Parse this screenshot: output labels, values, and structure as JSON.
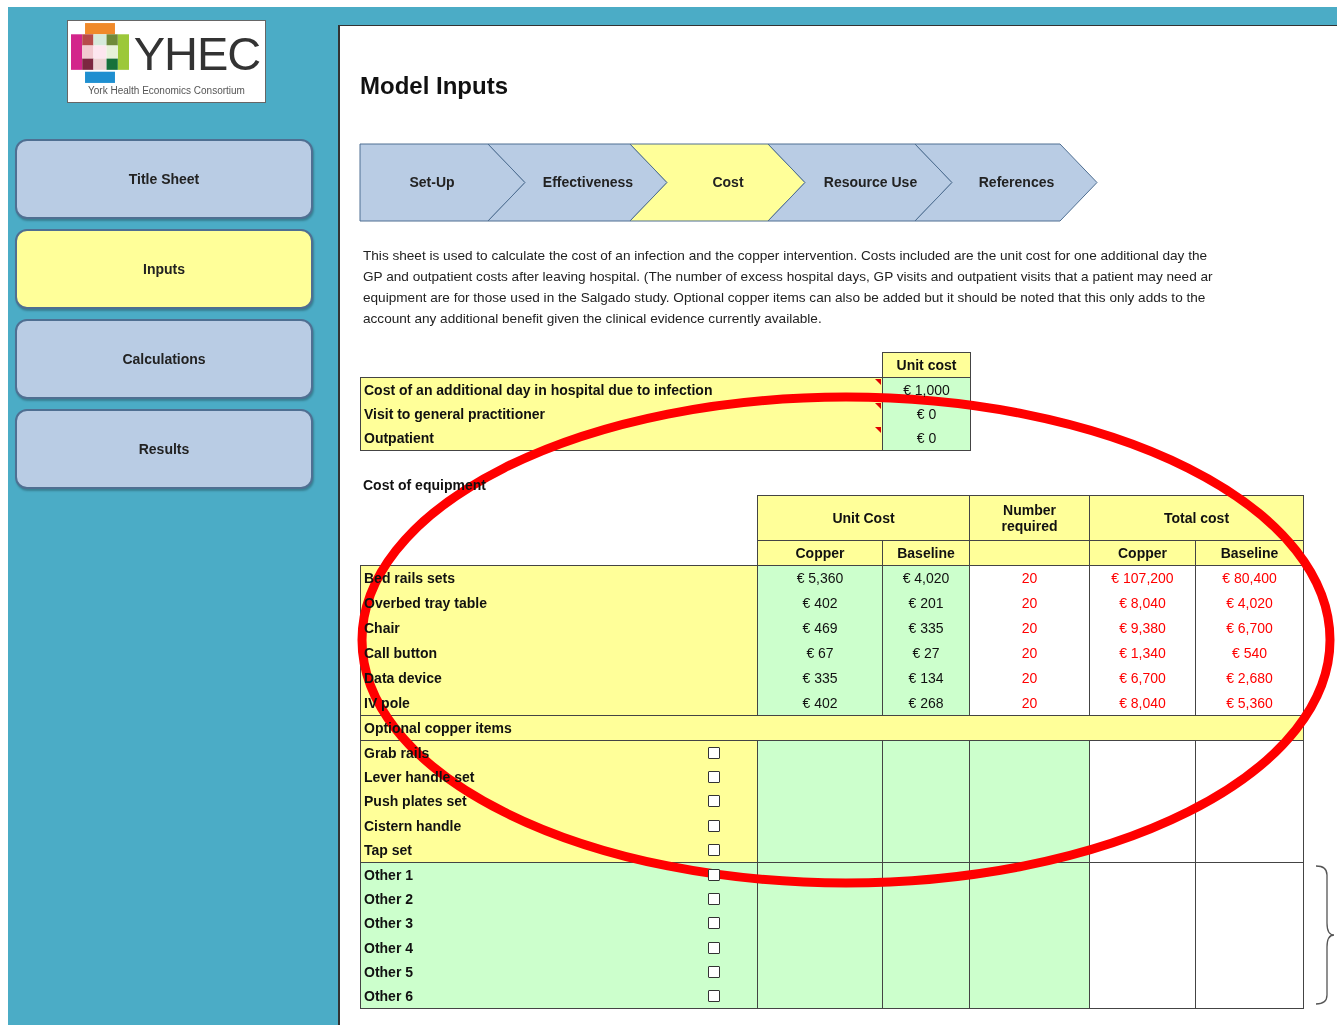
{
  "logo": {
    "title": "YHEC",
    "subtitle": "York Health Economics Consortium"
  },
  "nav": [
    {
      "label": "Title Sheet",
      "selected": false
    },
    {
      "label": "Inputs",
      "selected": true
    },
    {
      "label": "Calculations",
      "selected": false
    },
    {
      "label": "Results",
      "selected": false
    }
  ],
  "page_title": "Model Inputs",
  "steps": [
    {
      "label": "Set-Up",
      "selected": false
    },
    {
      "label": "Effectiveness",
      "selected": false
    },
    {
      "label": "Cost",
      "selected": true
    },
    {
      "label": "Resource Use",
      "selected": false
    },
    {
      "label": "References",
      "selected": false
    }
  ],
  "description": [
    "This sheet is used to calculate the cost of an infection and the copper intervention.  Costs included are the unit cost for one additional day the",
    "GP and outpatient costs after leaving hospital.  (The number of excess hospital days, GP visits and outpatient visits that a patient may need ar",
    "equipment are for those used in the Salgado study.  Optional copper items can also be added but it should be noted that this only adds to the",
    "account any additional benefit given the clinical evidence currently available."
  ],
  "unit_costs": {
    "column": "Unit cost",
    "rows": [
      {
        "label": "Cost of an additional day in hospital due to infection",
        "value": "€ 1,000",
        "comment": true
      },
      {
        "label": "Visit to general practitioner",
        "value": "€ 0",
        "comment": true
      },
      {
        "label": "Outpatient",
        "value": "€ 0",
        "comment": true
      }
    ]
  },
  "equipment": {
    "title": "Cost of equipment",
    "groups": [
      "Unit Cost",
      "Number required",
      "Total cost"
    ],
    "subcolumns": [
      "Copper",
      "Baseline",
      "Copper",
      "Baseline"
    ],
    "rows": [
      {
        "kind": "item",
        "label": "Bed rails sets",
        "values": [
          "€ 5,360",
          "€ 4,020",
          "20",
          "€ 107,200",
          "€ 80,400"
        ]
      },
      {
        "kind": "item",
        "label": "Overbed tray table",
        "values": [
          "€ 402",
          "€ 201",
          "20",
          "€ 8,040",
          "€ 4,020"
        ]
      },
      {
        "kind": "item",
        "label": "Chair",
        "values": [
          "€ 469",
          "€ 335",
          "20",
          "€ 9,380",
          "€ 6,700"
        ]
      },
      {
        "kind": "item",
        "label": "Call button",
        "values": [
          "€ 67",
          "€ 27",
          "20",
          "€ 1,340",
          "€ 540"
        ]
      },
      {
        "kind": "item",
        "label": "Data device",
        "values": [
          "€ 335",
          "€ 134",
          "20",
          "€ 6,700",
          "€ 2,680"
        ]
      },
      {
        "kind": "item",
        "label": "IV pole",
        "values": [
          "€ 402",
          "€ 268",
          "20",
          "€ 8,040",
          "€ 5,360"
        ]
      },
      {
        "kind": "section",
        "label": "Optional copper items"
      },
      {
        "kind": "optional",
        "label": "Grab rails",
        "checked": false
      },
      {
        "kind": "optional",
        "label": "Lever handle set",
        "checked": false
      },
      {
        "kind": "optional",
        "label": "Push plates set",
        "checked": false
      },
      {
        "kind": "optional",
        "label": "Cistern handle",
        "checked": false
      },
      {
        "kind": "optional",
        "label": "Tap set",
        "checked": false
      },
      {
        "kind": "other",
        "label": "Other 1",
        "checked": false
      },
      {
        "kind": "other",
        "label": "Other 2",
        "checked": false
      },
      {
        "kind": "other",
        "label": "Other 3",
        "checked": false
      },
      {
        "kind": "other",
        "label": "Other 4",
        "checked": false
      },
      {
        "kind": "other",
        "label": "Other 5",
        "checked": false
      },
      {
        "kind": "other",
        "label": "Other 6",
        "checked": false
      }
    ]
  }
}
